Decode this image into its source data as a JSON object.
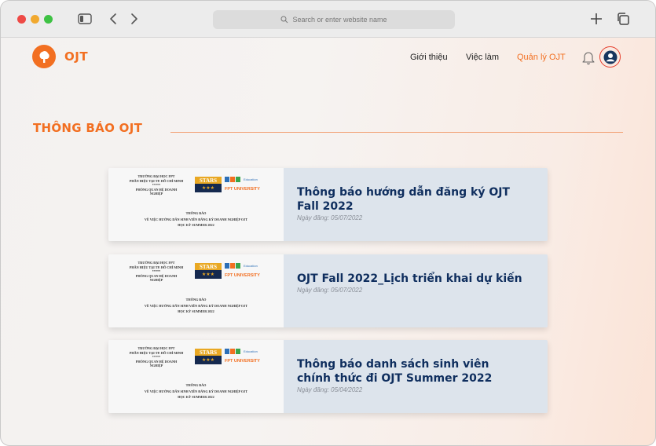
{
  "browser": {
    "address_placeholder": "Search or enter website name"
  },
  "site": {
    "logo_text": "OJT",
    "nav": [
      "Giới thiệu",
      "Việc làm",
      "Quản lý OJT"
    ],
    "accent": "#f26f21"
  },
  "section": {
    "title": "THÔNG BÁO OJT"
  },
  "thumbnail": {
    "school_line1": "TRƯỜNG ĐẠI HỌC FPT",
    "school_line2": "PHÂN HIỆU TẠI TP. HỒ CHÍ MINH",
    "school_line3": "*****",
    "school_line4": "PHÒNG QUAN HỆ DOANH NGHIỆP",
    "stars_label": "STARS",
    "stars_rating": "★★★",
    "fpt_edu": "Education",
    "fpt_univ": "FPT UNIVERSITY",
    "doc_line1": "THÔNG BÁO",
    "doc_line2": "VỀ VIỆC HƯỚNG DẪN SINH VIÊN ĐĂNG KÝ DOANH NGHIỆP OJT",
    "doc_line3": "HỌC KỲ SUMMER 2022"
  },
  "posts": [
    {
      "title": "Thông báo hướng dẫn đăng ký OJT Fall 2022",
      "date": "Ngày đăng: 05/07/2022"
    },
    {
      "title": "OJT Fall 2022_Lịch triển khai dự kiến",
      "date": "Ngày đăng: 05/07/2022"
    },
    {
      "title": "Thông báo danh sách sinh viên chính thức đi OJT Summer 2022",
      "date": "Ngày đăng: 05/04/2022"
    }
  ]
}
